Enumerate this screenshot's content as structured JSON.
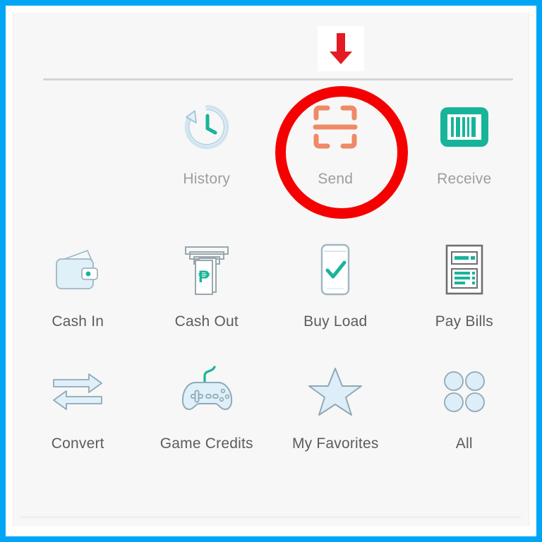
{
  "frame": {
    "border_color": "#00a6f5",
    "canvas_bg": "#f7f7f7"
  },
  "annotation": {
    "pointer_icon": "down-arrow-icon",
    "pointer_color": "#e31b23",
    "highlight_color": "#f40000",
    "highlighted_item": "Send"
  },
  "colors": {
    "teal": "#18b49a",
    "salmon": "#ef8a66",
    "light_blue_fill": "#dff0f9",
    "outline_grey": "#8d9aa3",
    "label_light": "#9d9d9d",
    "label_dark": "#5c5c5c"
  },
  "menu": {
    "rows": [
      {
        "items": [
          {
            "label": "History",
            "icon": "history-clock-icon",
            "label_style": "light"
          },
          {
            "label": "Send",
            "icon": "qr-scan-frame-icon",
            "label_style": "light",
            "highlighted": true
          },
          {
            "label": "Receive",
            "icon": "barcode-icon",
            "label_style": "light"
          }
        ]
      },
      {
        "items": [
          {
            "label": "Cash In",
            "icon": "wallet-icon",
            "label_style": "dark"
          },
          {
            "label": "Cash Out",
            "icon": "atm-machine-icon",
            "label_style": "dark"
          },
          {
            "label": "Buy Load",
            "icon": "phone-check-icon",
            "label_style": "dark"
          },
          {
            "label": "Pay Bills",
            "icon": "invoice-document-icon",
            "label_style": "dark"
          }
        ]
      },
      {
        "items": [
          {
            "label": "Convert",
            "icon": "two-way-arrows-icon",
            "label_style": "dark"
          },
          {
            "label": "Game Credits",
            "icon": "gamepad-icon",
            "label_style": "dark"
          },
          {
            "label": "My Favorites",
            "icon": "star-icon",
            "label_style": "dark"
          },
          {
            "label": "All",
            "icon": "grid-dots-icon",
            "label_style": "dark"
          }
        ]
      }
    ]
  }
}
